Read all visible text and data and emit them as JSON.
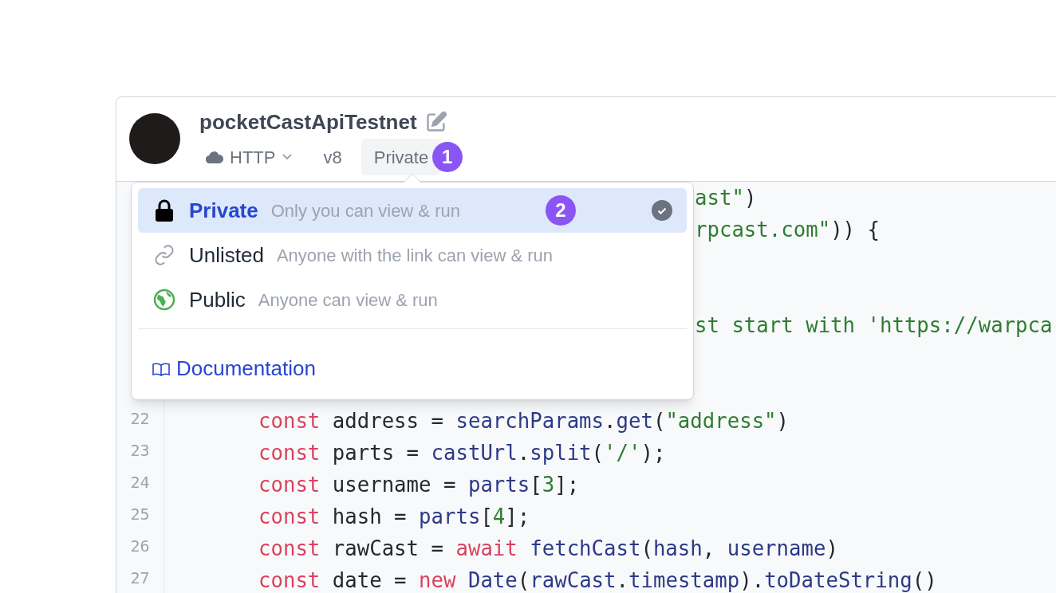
{
  "header": {
    "title": "pocketCastApiTestnet",
    "type": "HTTP",
    "version": "v8",
    "privacy": "Private",
    "privacy_badge": "1"
  },
  "privacy_menu": {
    "items": [
      {
        "kind": "lock",
        "label": "Private",
        "description": "Only you can view & run",
        "selected": true,
        "badge": "2"
      },
      {
        "kind": "link",
        "label": "Unlisted",
        "description": "Anyone with the link can view & run",
        "selected": false
      },
      {
        "kind": "globe",
        "label": "Public",
        "description": "Anyone can view & run",
        "selected": false
      }
    ],
    "footer_link": "Documentation"
  },
  "code": {
    "covered_fragments": [
      {
        "tokens": [
          {
            "kind": "str",
            "text": "ast\""
          },
          {
            "kind": "plain",
            "text": ")"
          }
        ]
      },
      {
        "tokens": [
          {
            "kind": "str",
            "text": "rpcast.com\""
          },
          {
            "kind": "plain",
            "text": ")) {"
          }
        ]
      },
      {
        "tokens": [
          {
            "kind": "str",
            "text": "st start with 'https://warpca"
          }
        ]
      }
    ],
    "lines": [
      {
        "number": "22",
        "tokens": [
          {
            "kind": "kw",
            "text": "const"
          },
          {
            "kind": "plain",
            "text": " address = "
          },
          {
            "kind": "fn",
            "text": "searchParams"
          },
          {
            "kind": "plain",
            "text": "."
          },
          {
            "kind": "fn",
            "text": "get"
          },
          {
            "kind": "plain",
            "text": "("
          },
          {
            "kind": "str",
            "text": "\"address\""
          },
          {
            "kind": "plain",
            "text": ")"
          }
        ]
      },
      {
        "number": "23",
        "tokens": [
          {
            "kind": "kw",
            "text": "const"
          },
          {
            "kind": "plain",
            "text": " parts = "
          },
          {
            "kind": "fn",
            "text": "castUrl"
          },
          {
            "kind": "plain",
            "text": "."
          },
          {
            "kind": "fn",
            "text": "split"
          },
          {
            "kind": "plain",
            "text": "("
          },
          {
            "kind": "str",
            "text": "'/'"
          },
          {
            "kind": "plain",
            "text": ");"
          }
        ]
      },
      {
        "number": "24",
        "tokens": [
          {
            "kind": "kw",
            "text": "const"
          },
          {
            "kind": "plain",
            "text": " username = "
          },
          {
            "kind": "fn",
            "text": "parts"
          },
          {
            "kind": "plain",
            "text": "["
          },
          {
            "kind": "str",
            "text": "3"
          },
          {
            "kind": "plain",
            "text": "];"
          }
        ]
      },
      {
        "number": "25",
        "tokens": [
          {
            "kind": "kw",
            "text": "const"
          },
          {
            "kind": "plain",
            "text": " hash = "
          },
          {
            "kind": "fn",
            "text": "parts"
          },
          {
            "kind": "plain",
            "text": "["
          },
          {
            "kind": "str",
            "text": "4"
          },
          {
            "kind": "plain",
            "text": "];"
          }
        ]
      },
      {
        "number": "26",
        "tokens": [
          {
            "kind": "kw",
            "text": "const"
          },
          {
            "kind": "plain",
            "text": " rawCast = "
          },
          {
            "kind": "kw",
            "text": "await "
          },
          {
            "kind": "fn",
            "text": "fetchCast"
          },
          {
            "kind": "plain",
            "text": "("
          },
          {
            "kind": "fn",
            "text": "hash"
          },
          {
            "kind": "plain",
            "text": ", "
          },
          {
            "kind": "fn",
            "text": "username"
          },
          {
            "kind": "plain",
            "text": ")"
          }
        ]
      },
      {
        "number": "27",
        "tokens": [
          {
            "kind": "kw",
            "text": "const"
          },
          {
            "kind": "plain",
            "text": " date = "
          },
          {
            "kind": "kw",
            "text": "new "
          },
          {
            "kind": "fn",
            "text": "Date"
          },
          {
            "kind": "plain",
            "text": "("
          },
          {
            "kind": "fn",
            "text": "rawCast"
          },
          {
            "kind": "plain",
            "text": "."
          },
          {
            "kind": "fn",
            "text": "timestamp"
          },
          {
            "kind": "plain",
            "text": ")."
          },
          {
            "kind": "fn",
            "text": "toDateString"
          },
          {
            "kind": "plain",
            "text": "()"
          }
        ]
      }
    ]
  }
}
